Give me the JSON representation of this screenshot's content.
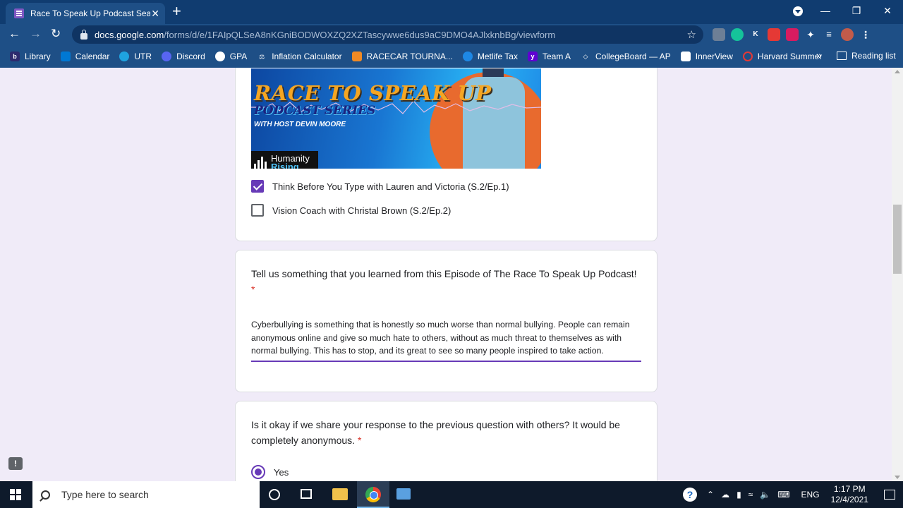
{
  "browser": {
    "tab_title": "Race To Speak Up Podcast Season",
    "tab_close": "✕",
    "new_tab": "+",
    "url_host": "docs.google.com",
    "url_path": "/forms/d/e/1FAIpQLSeA8nKGniBODWOXZQ2XZTascywwe6dus9aC9DMO4AJlxknbBg/viewform",
    "window_controls": {
      "minimize": "—",
      "restore": "❐",
      "close": "✕"
    }
  },
  "bookmarks": [
    {
      "label": "Library",
      "color": "#2d2a6e",
      "glyph": "b"
    },
    {
      "label": "Calendar",
      "color": "#0078d4",
      "glyph": ""
    },
    {
      "label": "UTR",
      "color": "#1fa3e0",
      "glyph": ""
    },
    {
      "label": "Discord",
      "color": "#5865f2",
      "glyph": ""
    },
    {
      "label": "GPA",
      "color": "#ffffff",
      "glyph": ""
    },
    {
      "label": "Inflation Calculator",
      "color": "#1e4f86",
      "glyph": "⚖"
    },
    {
      "label": "RACECAR TOURNA...",
      "color": "#f08a24",
      "glyph": ""
    },
    {
      "label": "Metlife Tax",
      "color": "#1e88e5",
      "glyph": ""
    },
    {
      "label": "Team A",
      "color": "#6001d2",
      "glyph": "y"
    },
    {
      "label": "CollegeBoard — AP",
      "color": "#1e4f86",
      "glyph": "◇"
    },
    {
      "label": "InnerView",
      "color": "#ffffff",
      "glyph": ""
    },
    {
      "label": "Harvard Summer",
      "color": "#a51c30",
      "glyph": ""
    }
  ],
  "bookmarks_more": "»",
  "reading_list": "Reading list",
  "form": {
    "banner": {
      "title": "RACE TO SPEAK UP",
      "subtitle": "PODCAST SERIES",
      "host": "WITH HOST DEVIN MOORE",
      "logo_line1": "Humanity",
      "logo_line2": "Rising"
    },
    "options": [
      {
        "label": "Think Before You Type with Lauren and Victoria (S.2/Ep.1)",
        "checked": true
      },
      {
        "label": "Vision Coach with Christal Brown (S.2/Ep.2)",
        "checked": false
      }
    ],
    "q2": {
      "question": "Tell us something that you learned from this Episode of The Race To Speak Up Podcast!",
      "required_mark": "*",
      "answer": "Cyberbullying is something that is honestly so much worse than normal bullying. People can remain anonymous online and give so much hate to others, without as much threat to themselves as with normal bullying. This has to stop, and its great to see so many people inspired to take action."
    },
    "q3": {
      "question": "Is it okay if we share your response to the previous question with others? It would be completely anonymous.",
      "required_mark": "*",
      "option_yes": "Yes"
    }
  },
  "taskbar": {
    "search_placeholder": "Type here to search",
    "language": "ENG",
    "time": "1:17 PM",
    "date": "12/4/2021"
  },
  "colors": {
    "accent": "#673ab7",
    "required": "#d93025",
    "chrome_frame": "#1e4f86"
  }
}
